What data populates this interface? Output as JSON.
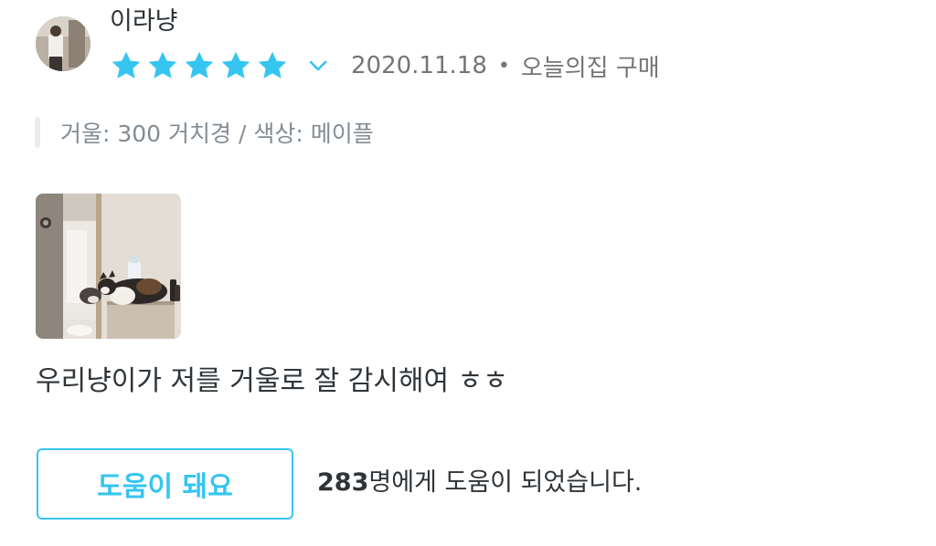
{
  "review": {
    "username": "이라냥",
    "rating": 5,
    "max_rating": 5,
    "star_color": "#35c5f0",
    "date": "2020.11.18",
    "separator": "•",
    "source": "오늘의집 구매",
    "option": "거울: 300 거치경 / 색상: 메이플",
    "text": "우리냥이가 저를 거울로 잘 감시해여 ㅎㅎ"
  },
  "helpful": {
    "button_label": "도움이 돼요",
    "count": "283",
    "suffix": "명에게 도움이 되었습니다.",
    "accent_color": "#35c5f0"
  },
  "icons": {
    "star": "star-icon",
    "expand": "chevron-down-icon"
  }
}
